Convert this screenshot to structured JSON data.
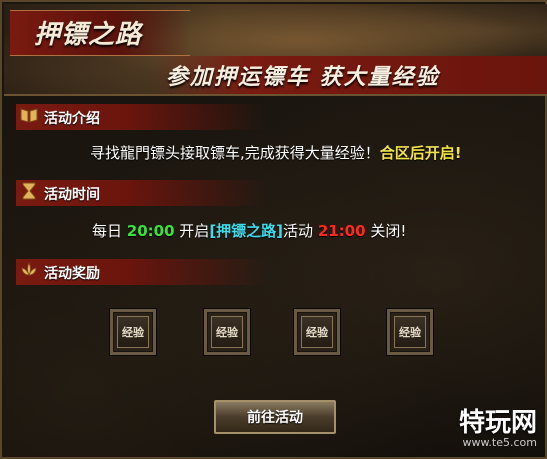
{
  "header": {
    "title": "押镖之路",
    "slogan": "参加押运镖车 获大量经验"
  },
  "sections": {
    "intro": {
      "label": "活动介绍",
      "icon": "book-icon"
    },
    "time": {
      "label": "活动时间",
      "icon": "hourglass-icon"
    },
    "reward": {
      "label": "活动奖励",
      "icon": "lotus-icon"
    }
  },
  "intro_text": {
    "part1": "寻找龍門镖头接取镖车,完成获得大量经验！",
    "part2": "合区后开启!"
  },
  "time_text": {
    "prefix": "每日 ",
    "start": "20:00",
    "open": " 开启",
    "event": "[押镖之路]",
    "mid": "活动 ",
    "end": "21:00",
    "close": " 关闭!"
  },
  "rewards": [
    {
      "label": "经验"
    },
    {
      "label": "经验"
    },
    {
      "label": "经验"
    },
    {
      "label": "经验"
    }
  ],
  "go_button": {
    "label": "前往活动"
  },
  "watermark": {
    "main": "特玩网",
    "sub": "www.te5.com"
  },
  "colors": {
    "accent_red": "#7a1a10",
    "highlight_yellow": "#f1e34a",
    "time_green": "#3be13b",
    "event_cyan": "#41d9e8",
    "time_red": "#ff2a1a"
  }
}
